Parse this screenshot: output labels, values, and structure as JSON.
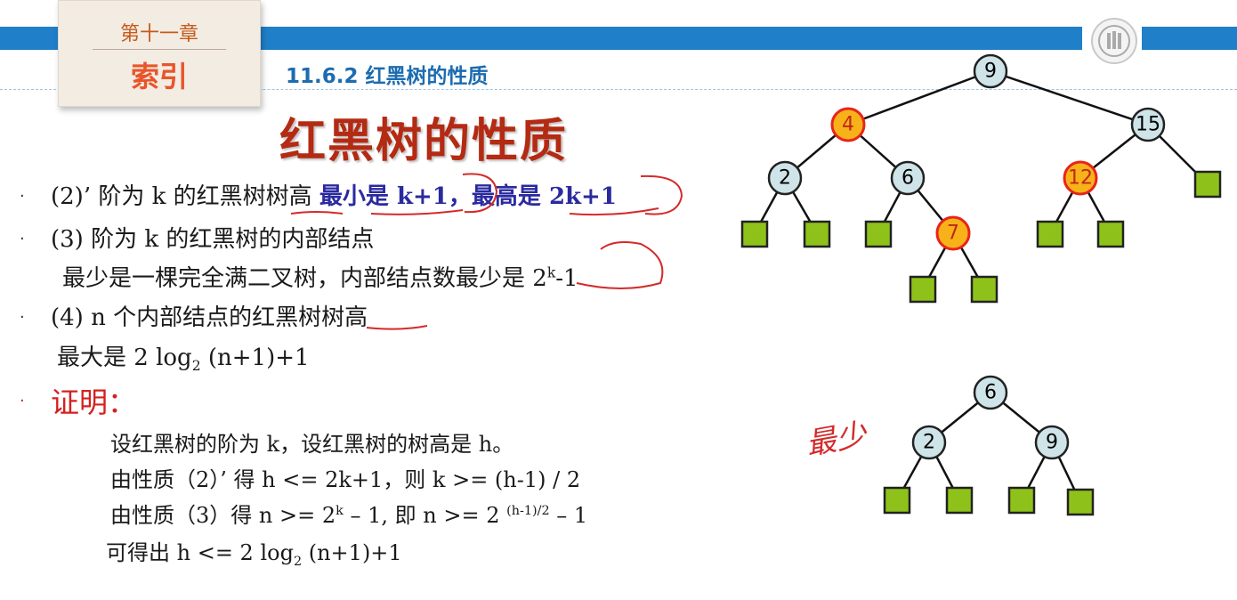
{
  "header": {
    "chapter": "第十一章",
    "chapter_name": "索引",
    "section": "11.6.2 红黑树的性质"
  },
  "title": "红黑树的性质",
  "properties": {
    "p2": {
      "bullet": "·",
      "prefix": "(2)’ 阶为 k 的红黑树树高 ",
      "min_label": "最小是 k+1",
      "sep": "，",
      "max_label": "最高是 2k+1"
    },
    "p3": {
      "bullet": "·",
      "line1": "(3) 阶为 k 的红黑树的内部结点",
      "line2_prefix": "最少是一棵完全满二叉树，内部结点数最少是 2",
      "line2_sup": "k",
      "line2_suffix": "-1"
    },
    "p4": {
      "bullet": "·",
      "line1": "(4)  n 个内部结点的红黑树树高",
      "line2_prefix": "最大是 2 log",
      "line2_sub": "2",
      "line2_suffix": " (n+1)+1"
    }
  },
  "proof": {
    "bullet": "·",
    "title": "证明：",
    "line1": "设红黑树的阶为 k，设红黑树的树高是 h。",
    "line2": "由性质（2）’ 得 h <= 2k+1，则 k >= (h-1) / 2",
    "line3_prefix": "由性质（3）得 n >= 2",
    "line3_sup1": "k",
    "line3_mid": " – 1, 即 n >= 2 ",
    "line3_sup2": "(h-1)/2",
    "line3_suffix": " – 1",
    "line4_prefix": "可得出 h <= 2 log",
    "line4_sub": "2",
    "line4_suffix": " (n+1)+1"
  },
  "annotation": "最少",
  "colors": {
    "black_node": "#cfe4e8",
    "red_node": "#f7b21a",
    "red_stroke": "#e8241a",
    "leaf": "#8ec21a",
    "bar": "#1f7fc9"
  },
  "tree1": {
    "nodes": [
      "9",
      "4",
      "15",
      "2",
      "6",
      "12",
      "7"
    ],
    "red_nodes": [
      "4",
      "12",
      "7"
    ]
  },
  "tree2": {
    "nodes": [
      "6",
      "2",
      "9"
    ]
  }
}
